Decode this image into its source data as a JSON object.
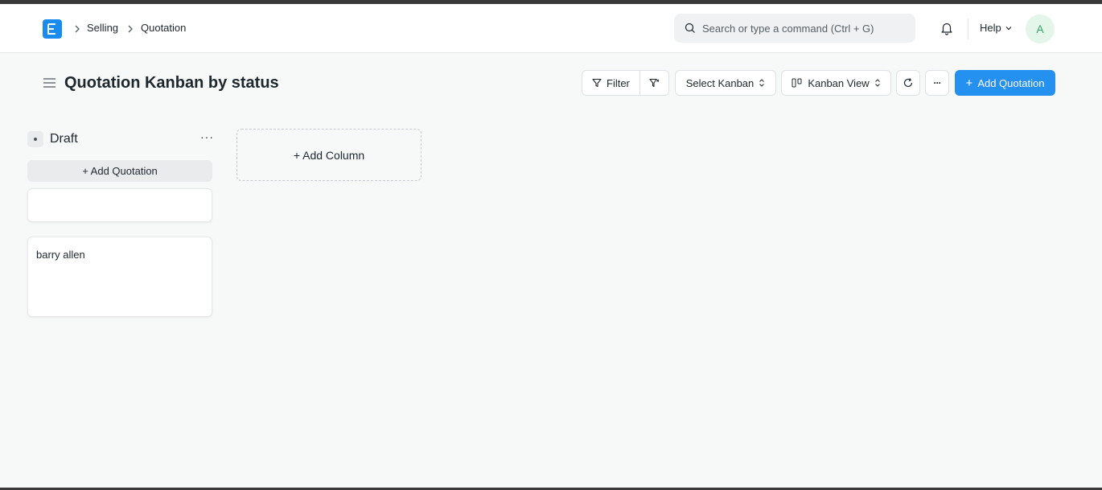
{
  "navbar": {
    "breadcrumbs": [
      "Selling",
      "Quotation"
    ],
    "search_placeholder": "Search or type a command (Ctrl + G)",
    "help_label": "Help",
    "avatar_initial": "A"
  },
  "page": {
    "title": "Quotation Kanban by status"
  },
  "toolbar": {
    "filter_label": "Filter",
    "select_kanban_label": "Select Kanban",
    "view_label": "Kanban View",
    "more_label": "···",
    "add_label": "Add Quotation",
    "add_prefix": "+"
  },
  "board": {
    "columns": [
      {
        "title": "Draft",
        "add_card_label": "+ Add Quotation",
        "cards": [
          {
            "title": ""
          },
          {
            "title": "barry allen"
          }
        ]
      }
    ],
    "add_column_label": "+ Add Column"
  },
  "colors": {
    "primary": "#2490ef",
    "logo": "#1a8cf0",
    "avatar_bg": "#e4f5e9",
    "avatar_fg": "#30a66d"
  }
}
